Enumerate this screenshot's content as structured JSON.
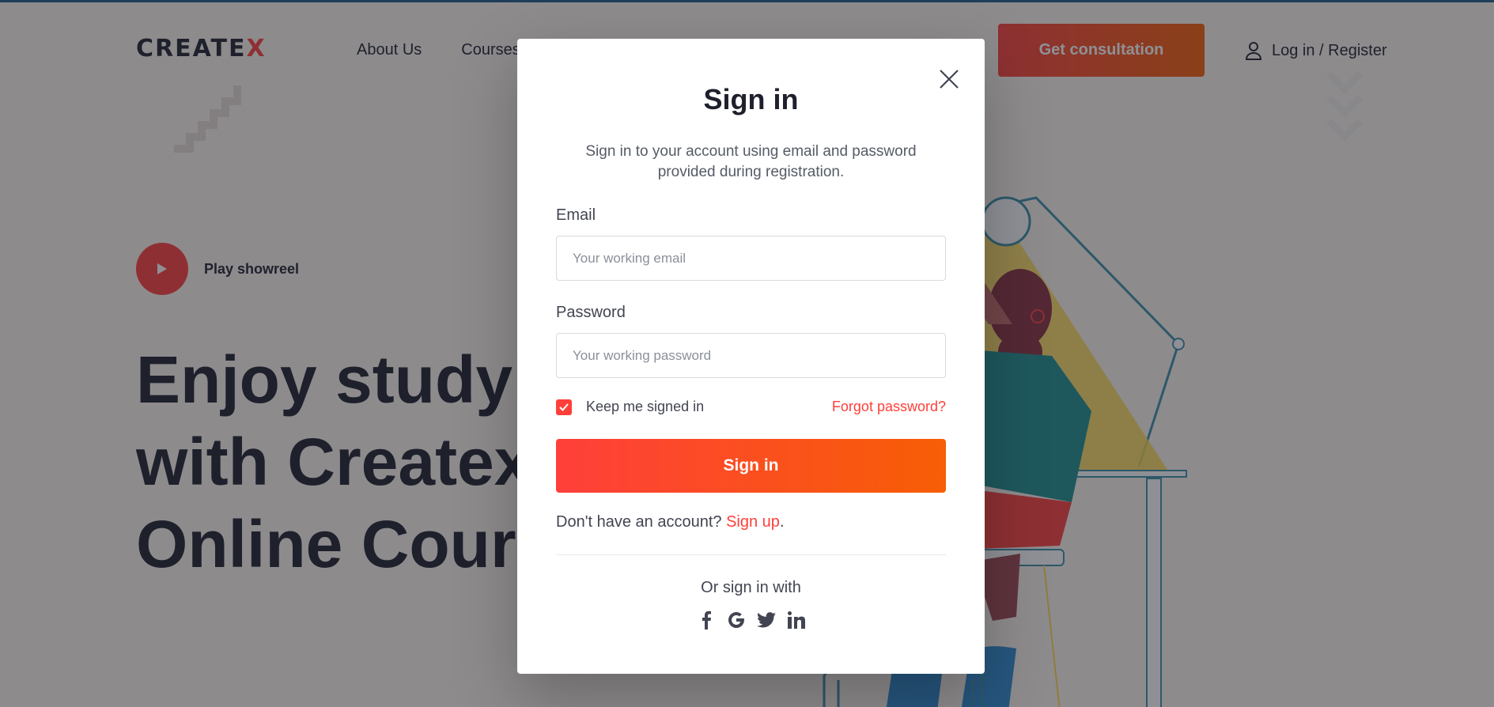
{
  "header": {
    "logo_text": "CREATE",
    "logo_accent": "X",
    "nav": [
      "About Us",
      "Courses"
    ],
    "consult_label": "Get consultation",
    "login_label": "Log in / Register"
  },
  "hero": {
    "play_label": "Play showreel",
    "title_line1": "Enjoy studying",
    "title_line2": "with Createx",
    "title_line3": "Online Courses"
  },
  "modal": {
    "title": "Sign in",
    "subtitle": "Sign in to your account using email and password provided during registration.",
    "email_label": "Email",
    "email_placeholder": "Your working email",
    "email_value": "",
    "password_label": "Password",
    "password_placeholder": "Your working password",
    "password_value": "",
    "keep_signed_label": "Keep me signed in",
    "keep_signed_checked": true,
    "forgot_label": "Forgot password?",
    "submit_label": "Sign in",
    "no_account_text": "Don't have an account?",
    "signup_label": "Sign up",
    "signup_suffix": ".",
    "or_text": "Or sign in with",
    "social_icons": [
      "facebook-icon",
      "google-icon",
      "twitter-icon",
      "linkedin-icon"
    ]
  },
  "colors": {
    "accent": "#ff3f3a",
    "accent_end": "#f75e05",
    "text_dark": "#1e212c",
    "overlay": "rgba(30,33,44,0.5)"
  }
}
